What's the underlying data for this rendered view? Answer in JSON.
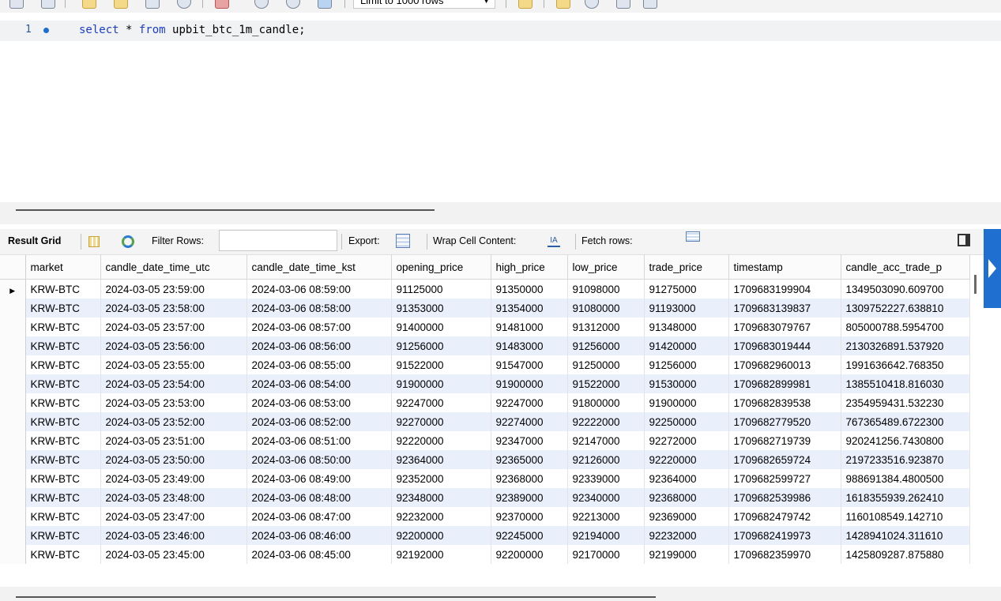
{
  "toolbar": {
    "limit_label": "Limit to 1000 rows"
  },
  "editor": {
    "line_number": "1",
    "query": {
      "kw_select": "select",
      "star": " * ",
      "kw_from": "from",
      "table": " upbit_btc_1m_candle;"
    }
  },
  "result_toolbar": {
    "result_grid": "Result Grid",
    "filter_rows": "Filter Rows:",
    "export": "Export:",
    "wrap": "Wrap Cell Content:",
    "fetch": "Fetch rows:"
  },
  "grid": {
    "columns": [
      "market",
      "candle_date_time_utc",
      "candle_date_time_kst",
      "opening_price",
      "high_price",
      "low_price",
      "trade_price",
      "timestamp",
      "candle_acc_trade_p"
    ],
    "rows": [
      [
        "KRW-BTC",
        "2024-03-05 23:59:00",
        "2024-03-06 08:59:00",
        "91125000",
        "91350000",
        "91098000",
        "91275000",
        "1709683199904",
        "1349503090.609700"
      ],
      [
        "KRW-BTC",
        "2024-03-05 23:58:00",
        "2024-03-06 08:58:00",
        "91353000",
        "91354000",
        "91080000",
        "91193000",
        "1709683139837",
        "1309752227.638810"
      ],
      [
        "KRW-BTC",
        "2024-03-05 23:57:00",
        "2024-03-06 08:57:00",
        "91400000",
        "91481000",
        "91312000",
        "91348000",
        "1709683079767",
        "805000788.5954700"
      ],
      [
        "KRW-BTC",
        "2024-03-05 23:56:00",
        "2024-03-06 08:56:00",
        "91256000",
        "91483000",
        "91256000",
        "91420000",
        "1709683019444",
        "2130326891.537920"
      ],
      [
        "KRW-BTC",
        "2024-03-05 23:55:00",
        "2024-03-06 08:55:00",
        "91522000",
        "91547000",
        "91250000",
        "91256000",
        "1709682960013",
        "1991636642.768350"
      ],
      [
        "KRW-BTC",
        "2024-03-05 23:54:00",
        "2024-03-06 08:54:00",
        "91900000",
        "91900000",
        "91522000",
        "91530000",
        "1709682899981",
        "1385510418.816030"
      ],
      [
        "KRW-BTC",
        "2024-03-05 23:53:00",
        "2024-03-06 08:53:00",
        "92247000",
        "92247000",
        "91800000",
        "91900000",
        "1709682839538",
        "2354959431.532230"
      ],
      [
        "KRW-BTC",
        "2024-03-05 23:52:00",
        "2024-03-06 08:52:00",
        "92270000",
        "92274000",
        "92222000",
        "92250000",
        "1709682779520",
        "767365489.6722300"
      ],
      [
        "KRW-BTC",
        "2024-03-05 23:51:00",
        "2024-03-06 08:51:00",
        "92220000",
        "92347000",
        "92147000",
        "92272000",
        "1709682719739",
        "920241256.7430800"
      ],
      [
        "KRW-BTC",
        "2024-03-05 23:50:00",
        "2024-03-06 08:50:00",
        "92364000",
        "92365000",
        "92126000",
        "92220000",
        "1709682659724",
        "2197233516.923870"
      ],
      [
        "KRW-BTC",
        "2024-03-05 23:49:00",
        "2024-03-06 08:49:00",
        "92352000",
        "92368000",
        "92339000",
        "92364000",
        "1709682599727",
        "988691384.4800500"
      ],
      [
        "KRW-BTC",
        "2024-03-05 23:48:00",
        "2024-03-06 08:48:00",
        "92348000",
        "92389000",
        "92340000",
        "92368000",
        "1709682539986",
        "1618355939.262410"
      ],
      [
        "KRW-BTC",
        "2024-03-05 23:47:00",
        "2024-03-06 08:47:00",
        "92232000",
        "92370000",
        "92213000",
        "92369000",
        "1709682479742",
        "1160108549.142710"
      ],
      [
        "KRW-BTC",
        "2024-03-05 23:46:00",
        "2024-03-06 08:46:00",
        "92200000",
        "92245000",
        "92194000",
        "92232000",
        "1709682419973",
        "1428941024.311610"
      ],
      [
        "KRW-BTC",
        "2024-03-05 23:45:00",
        "2024-03-06 08:45:00",
        "92192000",
        "92200000",
        "92170000",
        "92199000",
        "1709682359970",
        "1425809287.875880"
      ]
    ]
  }
}
